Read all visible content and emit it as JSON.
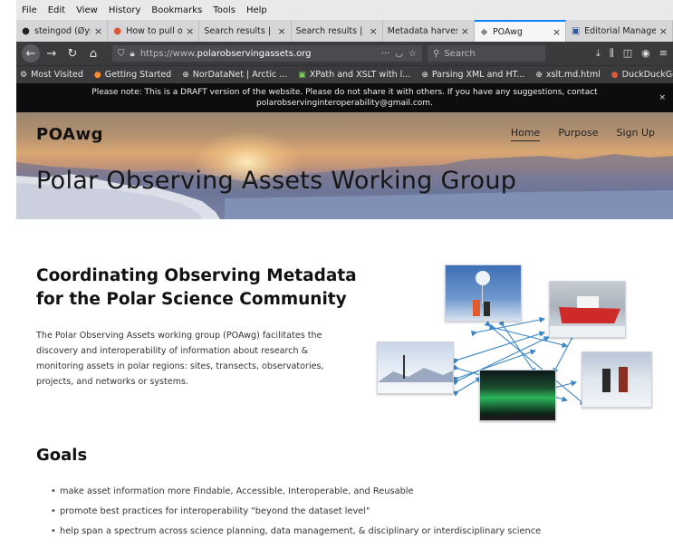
{
  "menubar": {
    "items": [
      "File",
      "Edit",
      "View",
      "History",
      "Bookmarks",
      "Tools",
      "Help"
    ]
  },
  "tabs": [
    {
      "icon": "github-icon",
      "title": "steingod (Øystein",
      "active": false
    },
    {
      "icon": "duckduckgo-icon",
      "title": "How to pull one",
      "active": false
    },
    {
      "icon": "search-icon",
      "title": "Search results | adc",
      "active": false
    },
    {
      "icon": "search-icon",
      "title": "Search results | Nor",
      "active": false
    },
    {
      "icon": "page-icon",
      "title": "Metadata harvests fr",
      "active": false
    },
    {
      "icon": "page-icon",
      "title": "POAwg",
      "active": true
    },
    {
      "icon": "editor-icon",
      "title": "Editorial Manager",
      "active": false
    }
  ],
  "navbar": {
    "url_protocol": "https://www.",
    "url_host": "polarobservingassets.org",
    "search_placeholder": "Search"
  },
  "bookmarks": [
    {
      "icon": "gear-icon",
      "label": "Most Visited"
    },
    {
      "icon": "firefox-icon",
      "label": "Getting Started"
    },
    {
      "icon": "globe-icon",
      "label": "NorDataNet | Arctic ..."
    },
    {
      "icon": "xslt-icon",
      "label": "XPath and XSLT with l..."
    },
    {
      "icon": "globe-icon",
      "label": "Parsing XML and HT..."
    },
    {
      "icon": "globe-icon",
      "label": "xslt.md.html"
    },
    {
      "icon": "duckduckgo-icon",
      "label": "DuckDuckGo — Priva..."
    }
  ],
  "notice": {
    "line1": "Please note:  This is a DRAFT version of the website.  Please do not share it with others.  If you have any suggestions, contact",
    "line2": "polarobservinginteroperability@gmail.com.",
    "close": "×"
  },
  "site": {
    "brand": "POAwg",
    "nav": [
      "Home",
      "Purpose",
      "Sign Up"
    ],
    "hero_title": "Polar Observing Assets Working Group"
  },
  "main": {
    "heading_line1": "Coordinating Observing Metadata",
    "heading_line2": "for the Polar Science Community",
    "intro": "The Polar Observing Assets working group (POAwg) facilitates the discovery and interoperability of information about research & monitoring assets in polar regions: sites, transects, observatories, projects, and networks or systems.",
    "goals_heading": "Goals",
    "goals": [
      "make asset information more Findable, Accessible, Interoperable, and Reusable",
      "promote best practices for interoperability \"beyond the dataset level\"",
      "help span a spectrum across science planning, data management, & disciplinary or interdisciplinary science"
    ]
  },
  "colors": {
    "active_tab_accent": "#0a84ff",
    "navbar_bg": "#3b3b3e",
    "notice_bg": "#0d0d0f",
    "arrow_color": "#3b86c6"
  }
}
